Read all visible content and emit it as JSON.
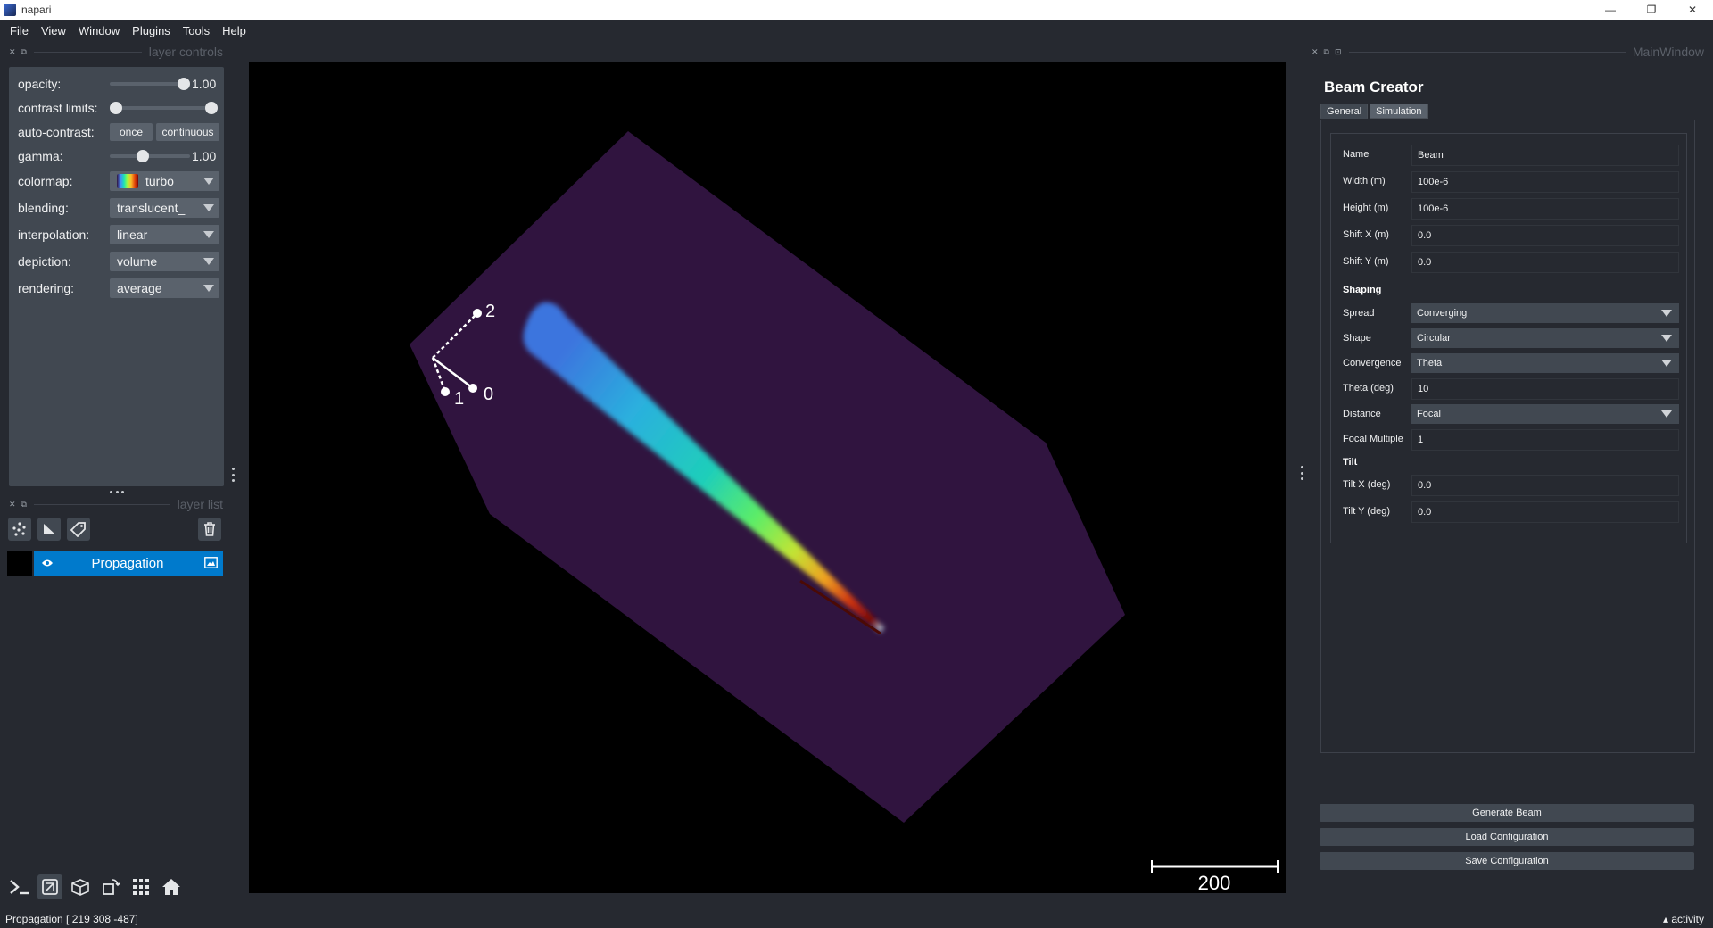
{
  "window": {
    "title": "napari",
    "minimize": "—",
    "maximize": "❐",
    "close": "✕"
  },
  "menu": [
    "File",
    "View",
    "Window",
    "Plugins",
    "Tools",
    "Help"
  ],
  "docks": {
    "layer_controls": "layer controls",
    "layer_list": "layer list",
    "main_window": "MainWindow"
  },
  "layer_controls": {
    "opacity": {
      "label": "opacity:",
      "value": "1.00",
      "fraction": 1.0
    },
    "contrast_limits": {
      "label": "contrast limits:",
      "low": 0.0,
      "high": 1.0
    },
    "auto_contrast": {
      "label": "auto-contrast:",
      "once": "once",
      "continuous": "continuous"
    },
    "gamma": {
      "label": "gamma:",
      "value": "1.00",
      "fraction": 0.5
    },
    "colormap": {
      "label": "colormap:",
      "value": "turbo"
    },
    "blending": {
      "label": "blending:",
      "value": "translucent_"
    },
    "interpolation": {
      "label": "interpolation:",
      "value": "linear"
    },
    "depiction": {
      "label": "depiction:",
      "value": "volume"
    },
    "rendering": {
      "label": "rendering:",
      "value": "average"
    }
  },
  "layers": [
    {
      "name": "Propagation",
      "visible": true,
      "selected": true
    }
  ],
  "canvas": {
    "axes": [
      "0",
      "1",
      "2"
    ],
    "scale_bar": "200",
    "colors": {
      "background": "#000000",
      "volume": "#30143f"
    }
  },
  "status": {
    "text": "Propagation [ 219 308 -487]",
    "activity": "activity"
  },
  "beam_creator": {
    "title": "Beam Creator",
    "tabs": [
      "General",
      "Simulation"
    ],
    "active_tab": "General",
    "fields": {
      "name": {
        "label": "Name",
        "value": "Beam"
      },
      "width": {
        "label": "Width (m)",
        "value": "100e-6"
      },
      "height": {
        "label": "Height (m)",
        "value": "100e-6"
      },
      "shift_x": {
        "label": "Shift X (m)",
        "value": "0.0"
      },
      "shift_y": {
        "label": "Shift Y (m)",
        "value": "0.0"
      }
    },
    "shaping": {
      "title": "Shaping",
      "spread": {
        "label": "Spread",
        "value": "Converging"
      },
      "shape": {
        "label": "Shape",
        "value": "Circular"
      },
      "convergence": {
        "label": "Convergence",
        "value": "Theta"
      },
      "theta": {
        "label": "Theta (deg)",
        "value": "10"
      },
      "distance": {
        "label": "Distance",
        "value": "Focal"
      },
      "focal_multiple": {
        "label": "Focal Multiple",
        "value": "1"
      }
    },
    "tilt": {
      "title": "Tilt",
      "tilt_x": {
        "label": "Tilt X (deg)",
        "value": "0.0"
      },
      "tilt_y": {
        "label": "Tilt Y (deg)",
        "value": "0.0"
      }
    },
    "buttons": {
      "generate": "Generate Beam",
      "load": "Load Configuration",
      "save": "Save Configuration"
    }
  }
}
